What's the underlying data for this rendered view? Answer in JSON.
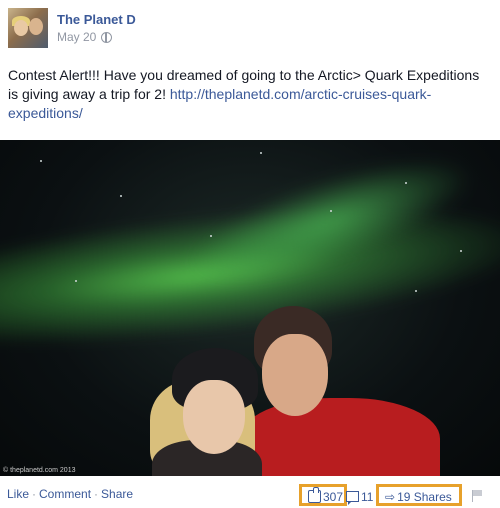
{
  "post": {
    "page_name": "The Planet D",
    "date": "May 20",
    "privacy_icon": "globe-icon",
    "text_before_link": "Contest Alert!!! Have you dreamed of going to the Arctic> Quark Expeditions is giving away a trip for 2! ",
    "link_text": "http://theplanetd.com/arctic-cruises-quark-expeditions/",
    "photo_watermark": "© theplanetd.com 2013"
  },
  "actions": {
    "like": "Like",
    "comment": "Comment",
    "share": "Share",
    "separator": "·"
  },
  "stats": {
    "likes": "307",
    "comments": "11",
    "shares": "19 Shares"
  },
  "colors": {
    "link": "#3b5998",
    "highlight_box": "#e7a12b",
    "meta_gray": "#9197a3"
  }
}
